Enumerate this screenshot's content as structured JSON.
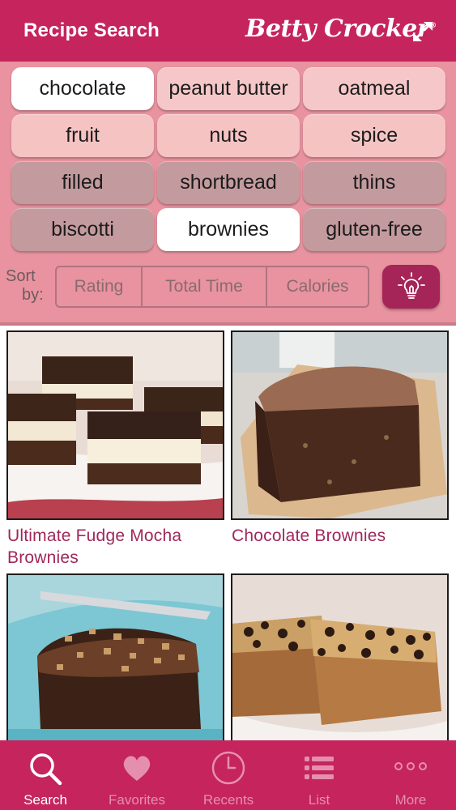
{
  "header": {
    "title": "Recipe Search",
    "brand": "Betty Crocker",
    "brand_mark": "®",
    "expand_icon": "expand-arrows-icon"
  },
  "filters": [
    {
      "label": "chocolate",
      "selected": true
    },
    {
      "label": "peanut butter",
      "selected": false
    },
    {
      "label": "oatmeal",
      "selected": false
    },
    {
      "label": "fruit",
      "selected": false
    },
    {
      "label": "nuts",
      "selected": false
    },
    {
      "label": "spice",
      "selected": false
    },
    {
      "label": "filled",
      "selected": false
    },
    {
      "label": "shortbread",
      "selected": false
    },
    {
      "label": "thins",
      "selected": false
    },
    {
      "label": "biscotti",
      "selected": false
    },
    {
      "label": "brownies",
      "selected": true
    },
    {
      "label": "gluten-free",
      "selected": false
    }
  ],
  "sort": {
    "label_line1": "Sort",
    "label_line2": "by:",
    "options": [
      "Rating",
      "Total Time",
      "Calories"
    ],
    "idea_icon": "lightbulb-icon"
  },
  "results": [
    {
      "title_line1": "Ultimate Fudge Mocha",
      "title_line2": "Brownies"
    },
    {
      "title_line1": "Chocolate Brownies",
      "title_line2": ""
    },
    {
      "title_line1": "",
      "title_line2": ""
    },
    {
      "title_line1": "",
      "title_line2": ""
    }
  ],
  "tabs": [
    {
      "label": "Search",
      "icon": "search-icon",
      "active": true
    },
    {
      "label": "Favorites",
      "icon": "heart-icon",
      "active": false
    },
    {
      "label": "Recents",
      "icon": "clock-icon",
      "active": false
    },
    {
      "label": "List",
      "icon": "list-icon",
      "active": false
    },
    {
      "label": "More",
      "icon": "more-dots-icon",
      "active": false
    }
  ],
  "colors": {
    "brand": "#c5245d",
    "panel": "#e8939f",
    "title_text": "#a0285a",
    "tab_inactive": "#e58fae"
  }
}
